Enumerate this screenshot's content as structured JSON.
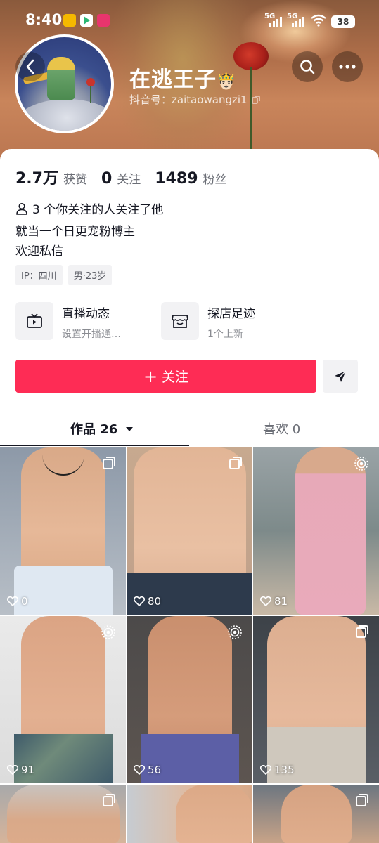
{
  "status_bar": {
    "time": "8:40",
    "network1": "5G",
    "network2": "5G",
    "battery": "38"
  },
  "profile": {
    "nickname": "在逃王子",
    "crown_emoji": "🤴🏻",
    "douyin_id": "抖音号：zaitaowangzi1",
    "stats": {
      "likes_value": "2.7万",
      "likes_label": "获赞",
      "following_value": "0",
      "following_label": "关注",
      "followers_value": "1489",
      "followers_label": "粉丝"
    },
    "mutual_text": "3 个你关注的人关注了他",
    "bio_line1": "就当一个日更宠粉博主",
    "bio_line2": "欢迎私信",
    "tag_ip": "IP：四川",
    "tag_gender_age": "男·23岁"
  },
  "features": {
    "live": {
      "title": "直播动态",
      "subtitle": "设置开播通…"
    },
    "shop": {
      "title": "探店足迹",
      "subtitle": "1个上新"
    }
  },
  "actions": {
    "follow_label": "关注",
    "follow_plus": "+"
  },
  "tabs": {
    "works_label": "作品 26",
    "likes_label": "喜欢 0"
  },
  "videos": [
    {
      "likes": "0",
      "badge": "multi-image-icon"
    },
    {
      "likes": "80",
      "badge": "multi-image-icon"
    },
    {
      "likes": "81",
      "badge": "live-photo-icon"
    },
    {
      "likes": "91",
      "badge": "live-photo-icon"
    },
    {
      "likes": "56",
      "badge": "live-photo-icon"
    },
    {
      "likes": "135",
      "badge": "multi-image-icon"
    },
    {
      "likes": "",
      "badge": "multi-image-icon"
    },
    {
      "likes": "",
      "badge": ""
    },
    {
      "likes": "",
      "badge": "multi-image-icon"
    }
  ],
  "colors": {
    "accent": "#fe2c55",
    "text_primary": "#161823",
    "text_secondary": "#6b6e76"
  }
}
